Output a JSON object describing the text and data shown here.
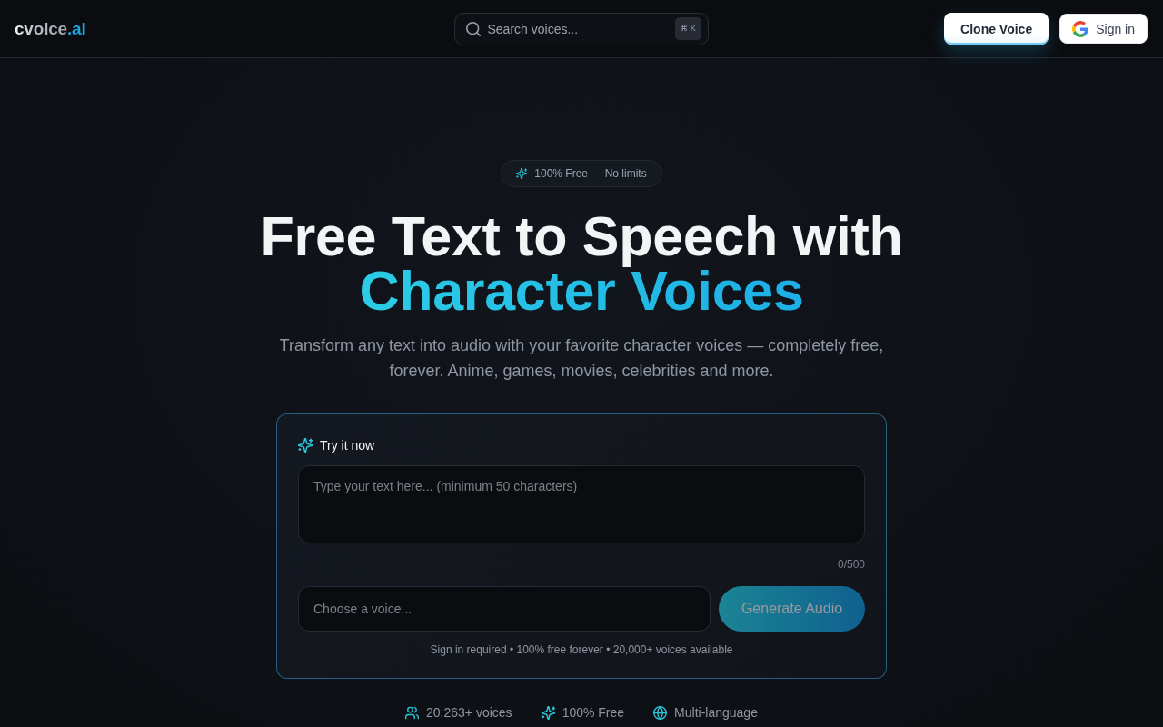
{
  "header": {
    "logo": {
      "text": "cvoice",
      "accent": ".ai"
    },
    "search": {
      "placeholder": "Search voices...",
      "shortcut": "⌘ K"
    },
    "buttons": [
      {
        "kind": "clone",
        "label": "Clone Voice"
      },
      {
        "kind": "google",
        "label": "Sign in"
      }
    ]
  },
  "hero": {
    "badge": "100% Free — No limits",
    "title": "Free Text to Speech with",
    "title_highlight": "Character Voices",
    "subtitle": "Transform any text into audio with your favorite character voices — completely free, forever. Anime, games, movies, celebrities and more."
  },
  "try_card": {
    "title": "Try it now",
    "text_input": {
      "placeholder": "Type your text here... (minimum 50 characters)"
    },
    "counter": "0/500",
    "voice_select": {
      "placeholder": "Choose a voice..."
    },
    "generate_button": {
      "label": "Generate Audio",
      "disabled": true
    },
    "note": "Sign in required • 100% free forever • 20,000+ voices available"
  },
  "stats": [
    {
      "kind": "users",
      "text": "20,263+ voices"
    },
    {
      "kind": "sparkles",
      "text": "100% Free"
    },
    {
      "kind": "globe",
      "text": "Multi-language"
    }
  ]
}
